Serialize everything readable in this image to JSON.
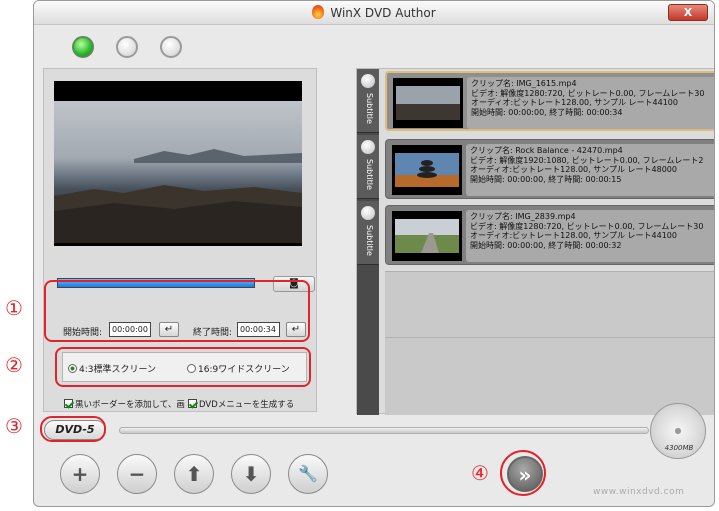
{
  "window": {
    "title": "WinX DVD Author",
    "close_label": "X"
  },
  "preview": {
    "camera_label": "◙"
  },
  "time": {
    "start_label": "開始時間:",
    "start_value": "00:00:00",
    "end_label": "終了時間:",
    "end_value": "00:00:34",
    "enter": "↵"
  },
  "aspect": {
    "option1": "4:3標準スクリーン",
    "option2": "16:9ワイドスクリーン",
    "selected": "4:3標準スクリーン"
  },
  "options": {
    "black_border": "黒いボーダーを添加して、画",
    "dvd_menu": "DVDメニューを生成する"
  },
  "dvd": {
    "label": "DVD-5",
    "capacity": "4300MB"
  },
  "callouts": [
    "①",
    "②",
    "③",
    "④"
  ],
  "subtitle_tab": "Subtitle",
  "clips": [
    {
      "line1": "クリップ名:  IMG_1615.mp4",
      "line2": "ビデオ:  解像度1280:720, ビットレート0.00, フレームレート30",
      "line3": "オーディオ:ビットレート128.00, サンプル レート44100",
      "line4": "開始時間:  00:00:00, 終了時間:  00:00:34"
    },
    {
      "line1": "クリップ名:  Rock Balance - 42470.mp4",
      "line2": "ビデオ:  解像度1920:1080, ビットレート0.00, フレームレート2",
      "line3": "オーディオ:ビットレート128.00, サンプル レート48000",
      "line4": "開始時間:  00:00:00, 終了時間:  00:00:15"
    },
    {
      "line1": "クリップ名:  IMG_2839.mp4",
      "line2": "ビデオ:  解像度1280:720, ビットレート0.00, フレームレート30",
      "line3": "オーディオ:ビットレート128.00, サンプル レート44100",
      "line4": "開始時間:  00:00:00, 終了時間:  00:00:32"
    }
  ],
  "toolbar": {
    "add": "+",
    "remove": "−",
    "up": "⬆",
    "down": "⬇",
    "settings": "🔧",
    "next": "»"
  },
  "brand": "www.winxdvd.com",
  "colors": {
    "callout": "#e0252a",
    "timeline": "#1a7de0",
    "active_light": "#2db82d"
  }
}
